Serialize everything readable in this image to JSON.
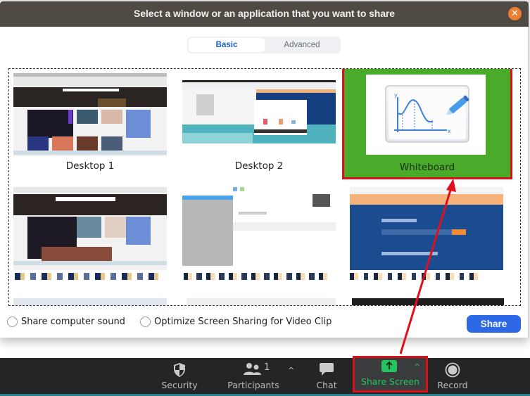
{
  "dialog": {
    "title": "Select a window or an application that you want to share",
    "close_icon": "close-icon"
  },
  "tabs": [
    {
      "label": "Basic",
      "active": true
    },
    {
      "label": "Advanced",
      "active": false
    }
  ],
  "tiles": [
    {
      "label": "Desktop 1",
      "selected": false
    },
    {
      "label": "Desktop 2",
      "selected": false
    },
    {
      "label": "Whiteboard",
      "selected": true
    },
    {
      "label": "",
      "selected": false
    },
    {
      "label": "",
      "selected": false
    },
    {
      "label": "",
      "selected": false
    }
  ],
  "options": {
    "share_sound": {
      "label": "Share computer sound",
      "checked": false
    },
    "optimize_video": {
      "label": "Optimize Screen Sharing for Video Clip",
      "checked": false
    }
  },
  "share_button": {
    "label": "Share",
    "color": "#2d68e6"
  },
  "toolbar": {
    "items": [
      {
        "label": "Security",
        "icon": "shield-icon"
      },
      {
        "label": "Participants",
        "icon": "participants-icon",
        "count": "1"
      },
      {
        "label": "Chat",
        "icon": "chat-icon"
      },
      {
        "label": "Share Screen",
        "icon": "share-screen-icon",
        "active_color": "#22c55e"
      },
      {
        "label": "Record",
        "icon": "record-icon"
      }
    ]
  },
  "colors": {
    "titlebar": "#4f4a44",
    "selected_tile": "#4aab2a",
    "highlight_border": "#d7101a",
    "toolbar_bg": "#242527"
  }
}
